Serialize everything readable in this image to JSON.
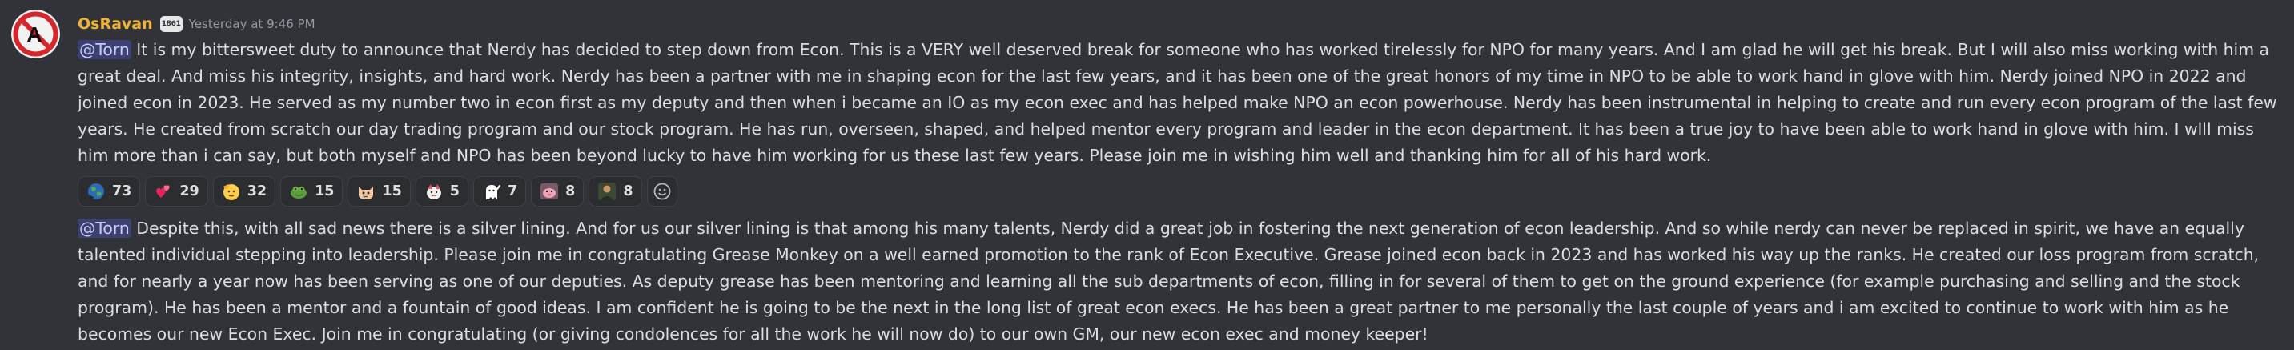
{
  "author": {
    "username": "OsRavan",
    "clan_tag": "1861",
    "timestamp": "Yesterday at 9:46 PM",
    "avatar_icon": "no-symbol-avatar-icon"
  },
  "messages": [
    {
      "mention": "@Torn",
      "text": " It is my bittersweet duty to announce that Nerdy has decided to step down from Econ.  This is a VERY well deserved break for someone who has worked tirelessly for NPO for many years.  And I am glad he will get his break.  But I will also miss working with him a great deal.  And miss his integrity, insights, and hard work. Nerdy has been a partner with me in shaping econ for the last few years, and it has been one of the great honors of my time in NPO to be able to work hand in glove with him. Nerdy joined NPO in 2022 and joined econ in 2023. He served as my number two in econ first as my deputy and then when i became an IO as my econ exec and has helped make NPO an econ powerhouse. Nerdy has been instrumental in helping to create and run every econ program of the last few years. He created from scratch our day trading program and our stock program.  He has run, overseen, shaped, and helped mentor every program and leader in the econ department.  It has been a true joy to have been able to work hand in glove with him. I wlll miss him more than i can say, but both myself and NPO has been beyond lucky to have him working for us these last few years.  Please join me in wishing him well and thanking him for all of his hard work."
    },
    {
      "mention": "@Torn",
      "text": " Despite this, with all sad news there is a silver lining. And for us our silver lining is that among his many talents, Nerdy did a great job in fostering the next generation of econ leadership. And so while nerdy can never be replaced in spirit, we have an  equally talented individual stepping into leadership. Please join me in congratulating Grease Monkey on a well earned promotion to the rank of Econ Executive. Grease joined econ back in 2023 and has worked his way up the ranks. He created our loss program from scratch, and for nearly a year now has been serving as one of our deputies. As deputy grease has been mentoring and learning all the sub departments of econ, filling in for several of them to get on the ground experience (for example purchasing and selling and the stock program). He has been a mentor and a fountain of good ideas. I am confident he is going to be the next in the long list of great econ execs. He has been a great partner to me personally the last couple of years and i am excited to continue to work with him as he becomes our new Econ Exec. Join me in congratulating (or giving condolences for all the work he will now do) to our own GM, our new econ exec and money keeper!"
    }
  ],
  "reactions": [
    {
      "icon": "globe-emoji-icon",
      "count": "73"
    },
    {
      "icon": "hearts-emoji-icon",
      "count": "29"
    },
    {
      "icon": "saluting-face-emoji-icon",
      "count": "32"
    },
    {
      "icon": "frog-emoji-icon",
      "count": "15"
    },
    {
      "icon": "crying-cat-emoji-icon",
      "count": "15"
    },
    {
      "icon": "sad-creature-emoji-icon",
      "count": "5"
    },
    {
      "icon": "waving-ghost-emoji-icon",
      "count": "7"
    },
    {
      "icon": "pink-creature-emoji-icon",
      "count": "8"
    },
    {
      "icon": "character-portrait-emoji-icon",
      "count": "8"
    }
  ],
  "add_reaction_icon": "add-reaction-smiley-icon",
  "colors": {
    "background": "#313338",
    "username": "#f0b232",
    "mention_bg": "rgba(88,101,242,0.3)",
    "mention_text": "#c9cdfb",
    "reaction_bg": "#2b2d31",
    "reaction_border": "#3f4147",
    "timestamp": "#949ba4"
  }
}
